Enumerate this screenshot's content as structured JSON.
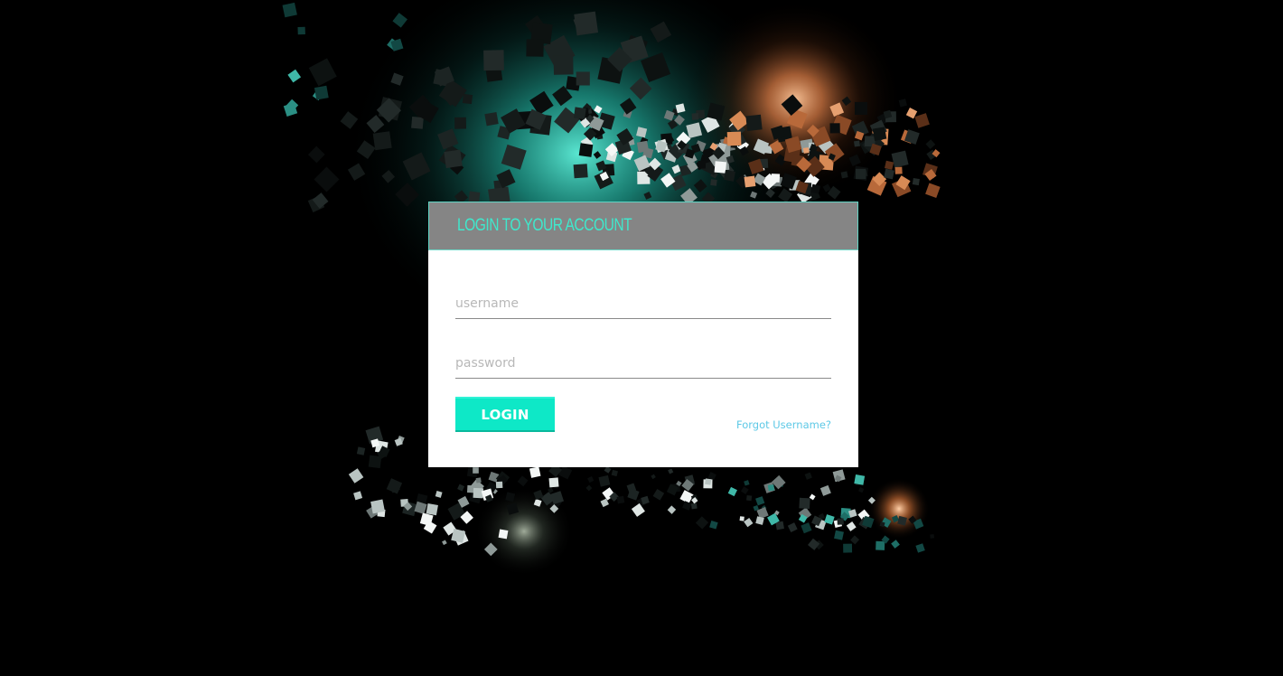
{
  "login": {
    "title": "LOGIN TO YOUR ACCOUNT",
    "username_placeholder": "username",
    "password_placeholder": "password",
    "login_label": "LOGIN",
    "forgot_label": "Forgot Username?"
  },
  "colors": {
    "accent": "#0ee8c7",
    "title_text": "#3fe8cc",
    "header_bg": "#858585",
    "link": "#5cc8e6",
    "background": "#000000",
    "glow_teal": "#2fd6c0",
    "glow_orange": "#f59a55"
  }
}
